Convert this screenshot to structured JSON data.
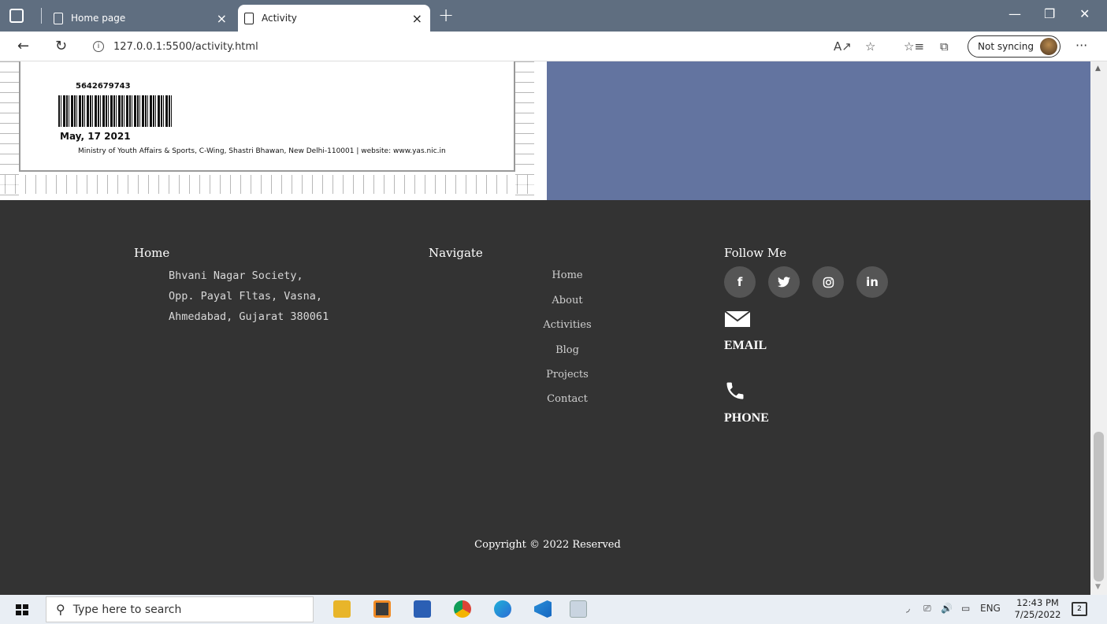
{
  "browser": {
    "tabs": [
      {
        "label": "Home page",
        "active": false
      },
      {
        "label": "Activity",
        "active": true
      }
    ],
    "new_tab_label": "+",
    "close_glyph": "×",
    "url": "127.0.0.1:5500/activity.html",
    "sync_label": "Not syncing",
    "more_label": "···"
  },
  "certificate": {
    "barcode_number": "5642679743",
    "date": "May, 17 2021",
    "ministry_text": "Ministry of Youth Affairs & Sports, C-Wing, Shastri Bhawan, New Delhi-110001 | website: www.yas.nic.in"
  },
  "footer": {
    "home": {
      "title": "Home",
      "address": [
        "Bhvani Nagar Society,",
        "Opp. Payal Fltas, Vasna,",
        "Ahmedabad, Gujarat 380061"
      ]
    },
    "navigate": {
      "title": "Navigate",
      "links": [
        "Home",
        "About",
        "Activities",
        "Blog",
        "Projects",
        "Contact"
      ]
    },
    "follow": {
      "title": "Follow Me",
      "social": [
        {
          "icon": "facebook-icon",
          "glyph": "f"
        },
        {
          "icon": "twitter-icon",
          "glyph": "🐦"
        },
        {
          "icon": "instagram-icon",
          "glyph": "◎"
        },
        {
          "icon": "linkedin-icon",
          "glyph": "in"
        }
      ],
      "email_label": "EMAIL",
      "phone_label": "PHONE"
    },
    "copyright": "Copyright © 2022 Reserved"
  },
  "taskbar": {
    "search_placeholder": "Type here to search",
    "language": "ENG",
    "time": "12:43 PM",
    "date": "7/25/2022",
    "notification_count": "2"
  },
  "colors": {
    "footer_bg": "#333333",
    "blue_panel": "#6374a0",
    "tabbar": "#5f6e80"
  }
}
